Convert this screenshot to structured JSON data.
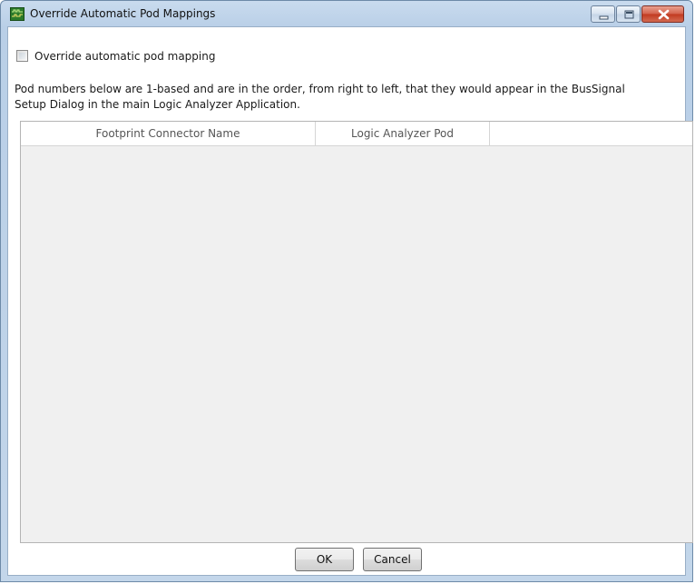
{
  "window": {
    "title": "Override Automatic Pod Mappings",
    "app_icon": "logic-analyzer-app-icon",
    "controls": [
      "minimize-icon",
      "maximize-icon",
      "close-icon"
    ]
  },
  "override": {
    "checkbox_label": "Override automatic pod mapping",
    "checked": false
  },
  "description": "Pod numbers below are 1-based and are in the order, from right to left, that they would appear in the BusSignal Setup Dialog in the main Logic Analyzer Application.",
  "grid": {
    "columns": [
      "Footprint Connector Name",
      "Logic Analyzer Pod"
    ],
    "rows": []
  },
  "footer": {
    "ok_label": "OK",
    "cancel_label": "Cancel"
  },
  "colors": {
    "title_bar": "#c3d6ea",
    "close_button": "#c1391f",
    "grid_background": "#f0f0f0"
  }
}
